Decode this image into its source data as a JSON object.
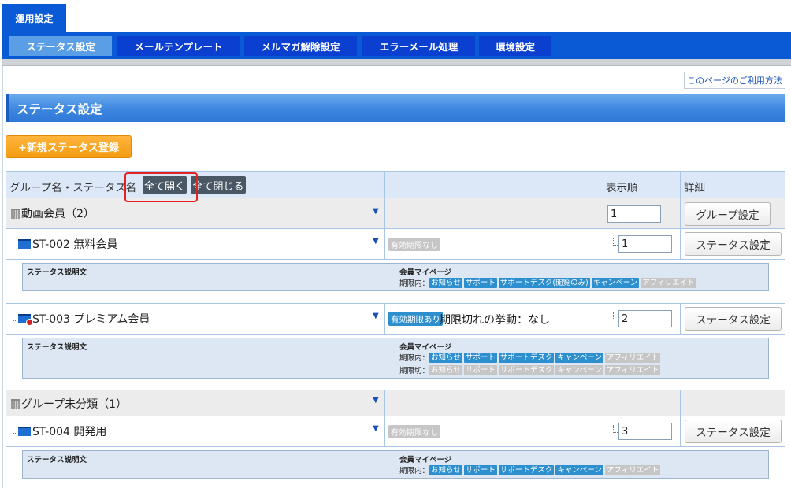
{
  "top_tab": {
    "label": "運用設定"
  },
  "nav": {
    "items": [
      {
        "label": "ステータス設定"
      },
      {
        "label": "メールテンプレート"
      },
      {
        "label": "メルマガ解除設定"
      },
      {
        "label": "エラーメール処理"
      },
      {
        "label": "環境設定"
      }
    ]
  },
  "help_link": "このページのご利用方法",
  "page_title": "ステータス設定",
  "new_status_button": "+新規ステータス登録",
  "table": {
    "header": {
      "name_col": "グループ名・ステータス名",
      "expand_all": "全て開く",
      "collapse_all": "全て閉じる",
      "order_col": "表示順",
      "detail_col": "詳細"
    },
    "triangle": "▼",
    "group1": {
      "label": "動画会員（2）",
      "order": "1",
      "button": "グループ設定"
    },
    "st002": {
      "label": "ST-002 無料会員",
      "badge": "有効期限なし",
      "order": "1",
      "button": "ステータス設定",
      "desc_label": "ステータス説明文",
      "mypage_label": "会員マイページ",
      "in_period_label": "期限内：",
      "tags_in": [
        "お知らせ",
        "サポート",
        "サポートデスク(閲覧のみ)",
        "キャンペーン",
        "アフィリエイト"
      ]
    },
    "st003": {
      "label": "ST-003 プレミアム会員",
      "badge": "有効期限あり",
      "expiry_text": "期限切れの挙動：なし",
      "order": "2",
      "button": "ステータス設定",
      "desc_label": "ステータス説明文",
      "mypage_label": "会員マイページ",
      "in_period_label": "期限内：",
      "out_period_label": "期限切：",
      "tags_in": [
        "お知らせ",
        "サポート",
        "サポートデスク",
        "キャンペーン",
        "アフィリエイト"
      ],
      "tags_out": [
        "お知らせ",
        "サポート",
        "サポートデスク",
        "キャンペーン",
        "アフィリエイト"
      ]
    },
    "group2": {
      "label": "グループ未分類（1）"
    },
    "st004": {
      "label": "ST-004 開発用",
      "badge": "有効期限なし",
      "order": "3",
      "button": "ステータス設定",
      "desc_label": "ステータス説明文",
      "mypage_label": "会員マイページ",
      "in_period_label": "期限内：",
      "tags_in": [
        "お知らせ",
        "サポート",
        "サポートデスク",
        "キャンペーン",
        "アフィリエイト"
      ]
    }
  },
  "colors": {
    "nav_blue": "#0a5ad6",
    "nav_active": "#5a9fe6",
    "accent_orange": "#f39c12",
    "tag_blue": "#2e8fce",
    "tag_gray": "#c6c6c6",
    "callout_red": "#e52222"
  }
}
